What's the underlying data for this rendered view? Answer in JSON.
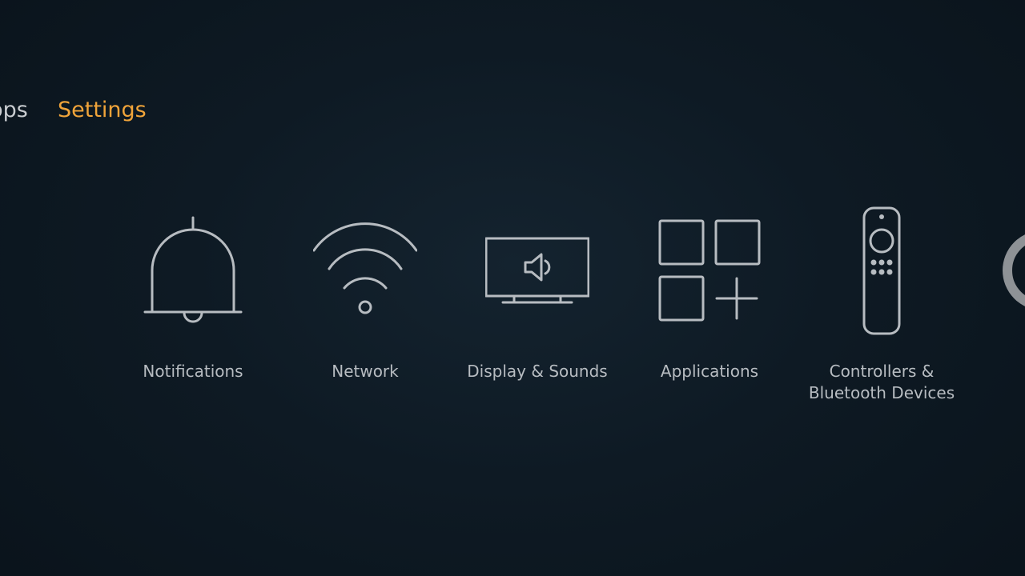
{
  "top_nav": {
    "items": [
      {
        "label": "Apps"
      },
      {
        "label": "Settings",
        "active": true
      }
    ],
    "active_color": "#f0a43a"
  },
  "settings_tiles": [
    {
      "label": "Notifications",
      "icon": "bell-icon"
    },
    {
      "label": "Network",
      "icon": "wifi-icon"
    },
    {
      "label": "Display & Sounds",
      "icon": "tv-speaker-icon"
    },
    {
      "label": "Applications",
      "icon": "apps-grid-icon"
    },
    {
      "label_line1": "Controllers &",
      "label_line2": "Bluetooth Devices",
      "icon": "remote-control-icon"
    }
  ],
  "offscreen_next_tile": {
    "icon": "partial-circle-icon"
  }
}
